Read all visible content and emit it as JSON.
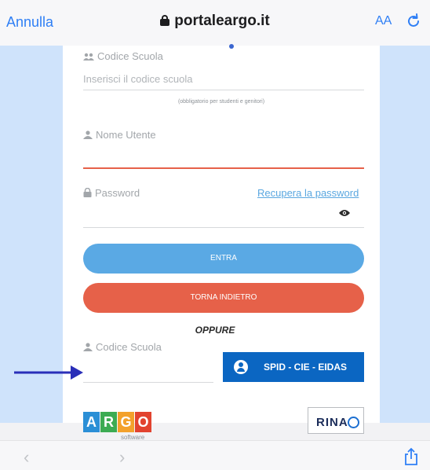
{
  "browser": {
    "cancel_label": "Annulla",
    "url": "portaleargo.it",
    "text_size_label": "AA",
    "reload_icon": "reload-icon",
    "lock_icon": "lock-icon",
    "accent_color": "#2f7ff5"
  },
  "form": {
    "school_code_label": "Codice Scuola",
    "school_code_placeholder": "Inserisci il codice scuola",
    "school_code_hint": "(obbligatorio per studenti e genitori)",
    "username_label": "Nome Utente",
    "username_value": "",
    "password_label": "Password",
    "recover_password_link": "Recupera la password",
    "login_button": "ENTRA",
    "back_button": "TORNA INDIETRO",
    "or_separator": "OPPURE",
    "spid_school_code_label": "Codice Scuola",
    "spid_button": "SPID - CIE - EIDAS",
    "login_button_color": "#5aa9e4",
    "back_button_color": "#e66149",
    "spid_button_color": "#0b66c2",
    "focus_line_color": "#e66149"
  },
  "footer": {
    "argo_letters": [
      "A",
      "R",
      "G",
      "O"
    ],
    "argo_sub": "software",
    "rina_text": "RINA"
  },
  "annotation": {
    "arrow_color": "#2a2fb8"
  }
}
